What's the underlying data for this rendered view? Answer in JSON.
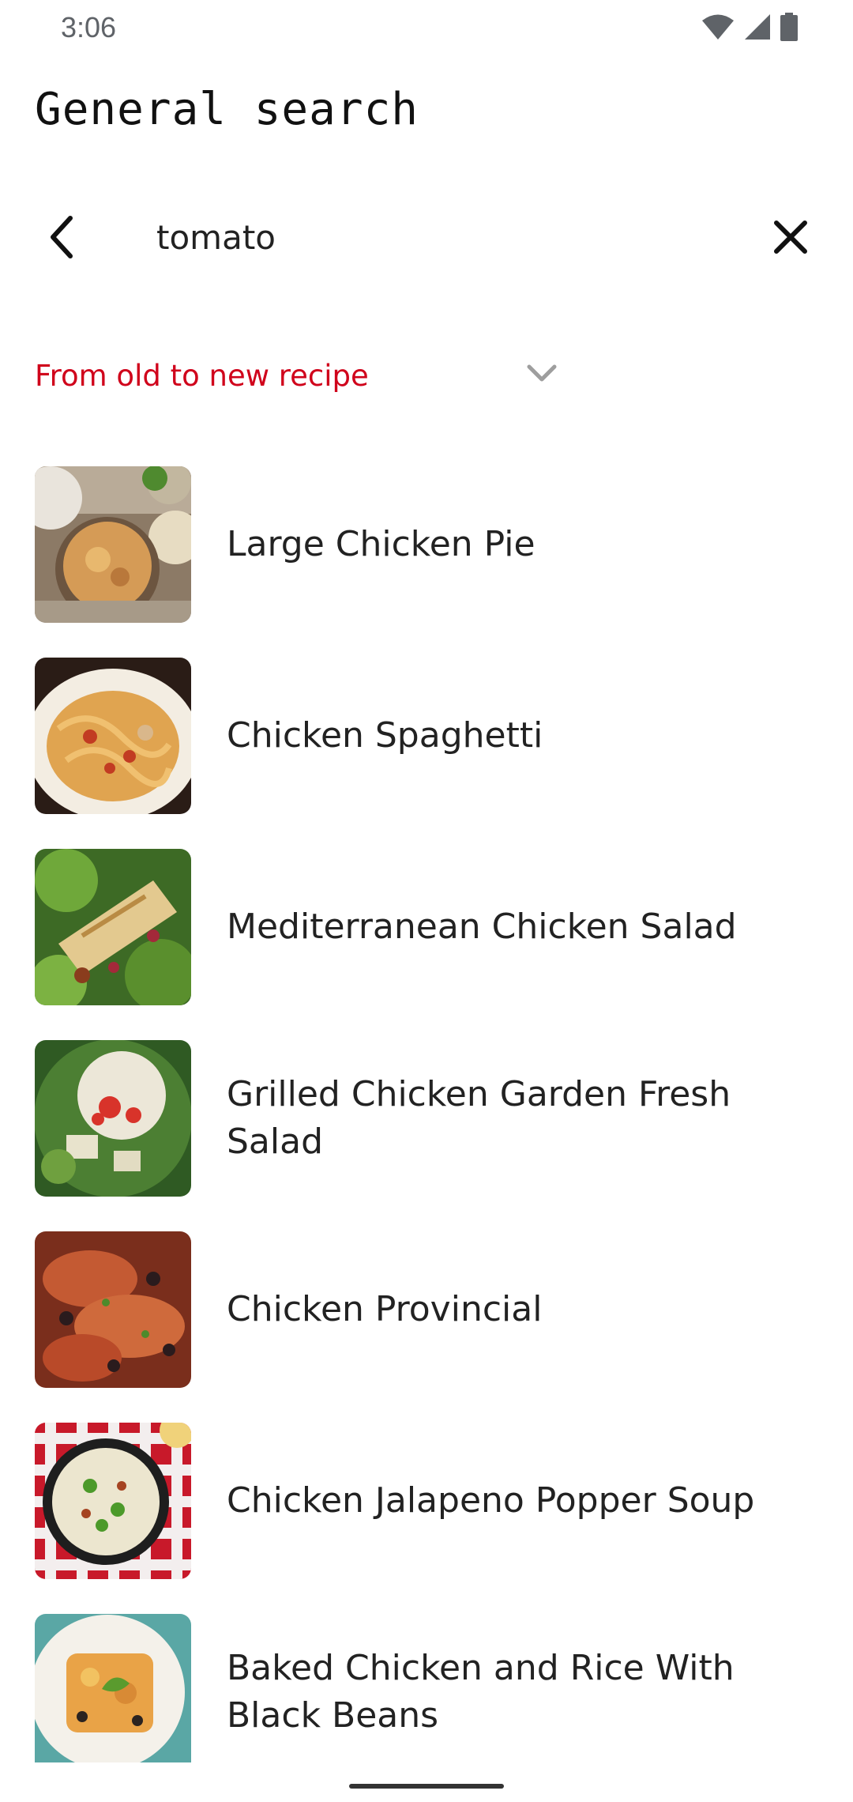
{
  "status_bar": {
    "time": "3:06",
    "icons": [
      "wifi-icon",
      "signal-icon",
      "battery-icon"
    ]
  },
  "header": {
    "title": "General search"
  },
  "search": {
    "query": "tomato",
    "back_icon": "chevron-left-icon",
    "clear_icon": "close-icon"
  },
  "sort": {
    "selected": "From old to new recipe",
    "accent_color": "#d0021b",
    "icon": "chevron-down-icon"
  },
  "results": [
    {
      "title": "Large Chicken Pie"
    },
    {
      "title": "Chicken Spaghetti"
    },
    {
      "title": "Mediterranean Chicken Salad"
    },
    {
      "title": "Grilled Chicken Garden Fresh Salad"
    },
    {
      "title": "Chicken Provincial"
    },
    {
      "title": "Chicken Jalapeno Popper Soup"
    },
    {
      "title": "Baked Chicken and Rice With Black Beans"
    }
  ]
}
